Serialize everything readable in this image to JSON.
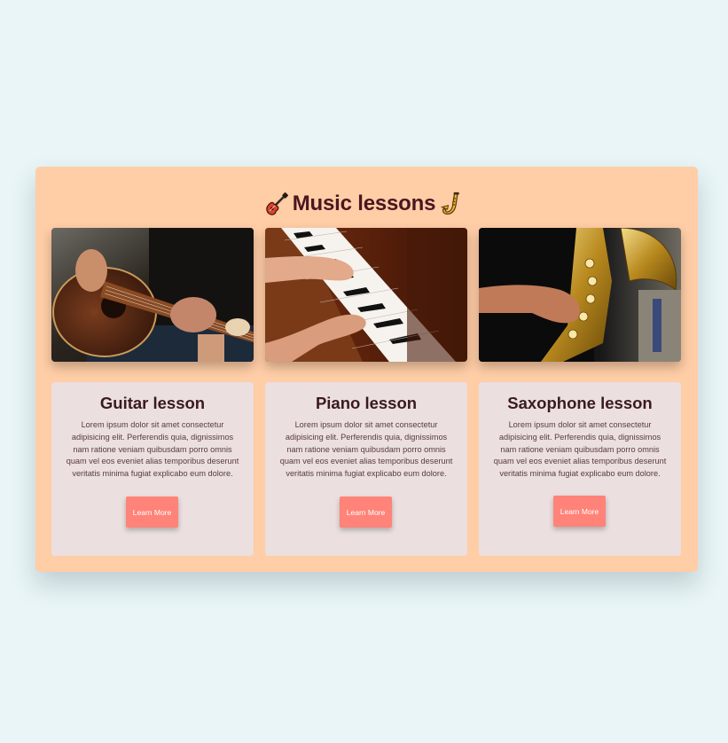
{
  "section": {
    "title": "Music lessons",
    "title_left_icon": "guitar-icon",
    "title_right_icon": "saxophone-icon"
  },
  "colors": {
    "page_background": "#e9f5f6",
    "panel_background": "#ffcda6",
    "card_background": "#ebdfdf",
    "button_background": "#ff8378",
    "heading_color": "#4a1620"
  },
  "cards": [
    {
      "image": "guitar-player-photo",
      "title": "Guitar lesson",
      "body": "Lorem ipsum dolor sit amet consectetur adipisicing elit. Perferendis quia, dignissimos nam ratione veniam quibusdam porro omnis quam vel eos eveniet alias temporibus deserunt veritatis minima fugiat explicabo eum dolore.",
      "button_label": "Learn More"
    },
    {
      "image": "piano-hands-photo",
      "title": "Piano lesson",
      "body": "Lorem ipsum dolor sit amet consectetur adipisicing elit. Perferendis quia, dignissimos nam ratione veniam quibusdam porro omnis quam vel eos eveniet alias temporibus deserunt veritatis minima fugiat explicabo eum dolore.",
      "button_label": "Learn More"
    },
    {
      "image": "saxophone-player-photo",
      "title": "Saxophone lesson",
      "body": "Lorem ipsum dolor sit amet consectetur adipisicing elit. Perferendis quia, dignissimos nam ratione veniam quibusdam porro omnis quam vel eos eveniet alias temporibus deserunt veritatis minima fugiat explicabo eum dolore.",
      "button_label": "Learn More"
    }
  ]
}
